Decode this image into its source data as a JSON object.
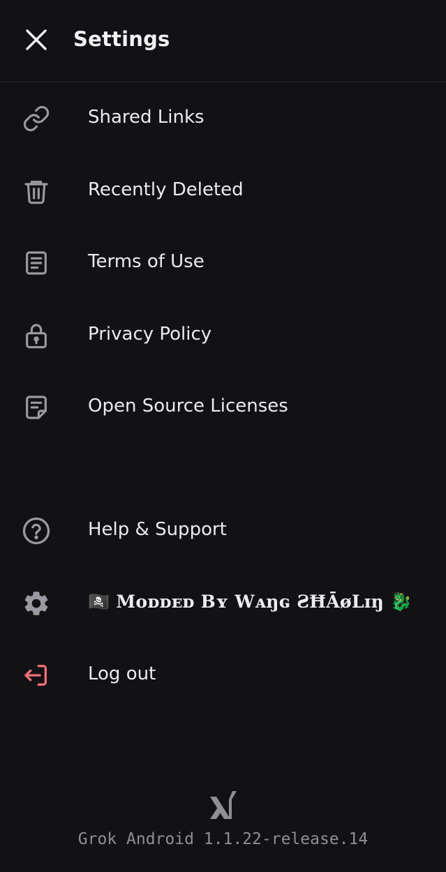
{
  "header": {
    "title": "Settings",
    "close_icon": "close-icon"
  },
  "menu": {
    "items": [
      {
        "label": "Shared Links",
        "icon": "link-icon"
      },
      {
        "label": "Recently Deleted",
        "icon": "trash-icon"
      },
      {
        "label": "Terms of Use",
        "icon": "document-icon"
      },
      {
        "label": "Privacy Policy",
        "icon": "lock-icon"
      },
      {
        "label": "Open Source Licenses",
        "icon": "license-document-icon"
      },
      {
        "label": "Help & Support",
        "icon": "help-circle-icon"
      },
      {
        "label": "🏴‍☠️ Mᴏᴅᴅᴇᴅ Bʏ Wᴀŋɢ ƧĦĀøLɪŋ 🐉",
        "icon": "gear-icon"
      },
      {
        "label": "Log out",
        "icon": "logout-icon",
        "color": "#f07178"
      }
    ]
  },
  "footer": {
    "logo": "xai-logo",
    "version": "Grok Android 1.1.22-release.14"
  },
  "colors": {
    "background": "#121214",
    "text": "#ececef",
    "icon": "#9a9aa0",
    "danger": "#f07178"
  }
}
